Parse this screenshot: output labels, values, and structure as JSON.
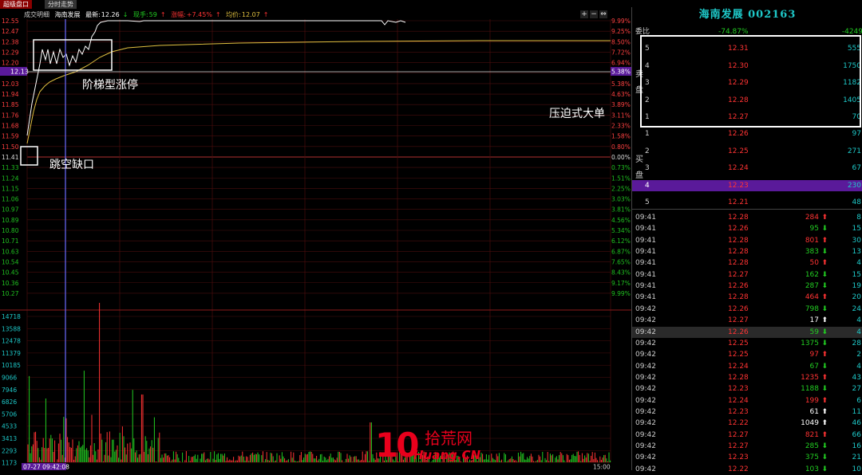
{
  "tabs": [
    {
      "label": "超级盘口",
      "active": true
    },
    {
      "label": "分时走势",
      "active": false
    }
  ],
  "info": {
    "prefix": "成交明细",
    "name": "海南发展",
    "latest_label": "最新:",
    "latest": "12.26",
    "volume_label": "现手:",
    "volume": "59",
    "change_label": "涨幅:",
    "change": "+7.45%",
    "avg_label": "均价:",
    "avg": "12.07"
  },
  "controls": [
    "+",
    "−",
    "⇔"
  ],
  "price_axis": [
    "12.55",
    "12.47",
    "12.38",
    "12.29",
    "12.20",
    "12.11",
    "12.03",
    "11.94",
    "11.85",
    "11.76",
    "11.68",
    "11.59",
    "11.50",
    "11.41",
    "11.33",
    "11.24",
    "11.15",
    "11.06",
    "10.97",
    "10.89",
    "10.80",
    "10.71",
    "10.63",
    "10.54",
    "10.45",
    "10.36",
    "10.27"
  ],
  "pct_axis": [
    "9.99%",
    "9.25%",
    "8.50%",
    "7.72%",
    "6.94%",
    "6.16%",
    "5.38%",
    "4.63%",
    "3.89%",
    "3.11%",
    "2.33%",
    "1.58%",
    "0.80%",
    "0.00%",
    "0.73%",
    "1.51%",
    "2.25%",
    "3.03%",
    "3.81%",
    "4.56%",
    "5.34%",
    "6.12%",
    "6.87%",
    "7.65%",
    "8.43%",
    "9.17%",
    "9.99%"
  ],
  "highlight_price": "12.13",
  "highlight_pct": "5.38%",
  "vol_axis": [
    "14718",
    "13588",
    "12478",
    "11379",
    "10185",
    "9066",
    "7946",
    "6826",
    "5706",
    "4533",
    "3413",
    "2293",
    "1173"
  ],
  "time_start": "07-27 09:42:08",
  "time_end": "15:00",
  "annotations": {
    "ladder": "阶梯型涨停",
    "gap": "跳空缺口",
    "pressure": "压迫式大单"
  },
  "watermark": {
    "num": "10",
    "cn": "拾荒网",
    "en": "Huang.CN"
  },
  "chart_data": {
    "type": "line",
    "y_range": [
      10.27,
      12.55
    ],
    "x_range": [
      "09:30",
      "15:00"
    ],
    "price_series_note": "",
    "volume_axis_range": [
      0,
      14718
    ]
  },
  "panel": {
    "title": "海南发展 002163",
    "weibi_label": "委比",
    "weibi_value": "-74.87%",
    "weicha_value": "-4249",
    "sell_label": "卖盘",
    "buy_label": "买盘",
    "sell": [
      {
        "level": "5",
        "price": "12.31",
        "vol": "555"
      },
      {
        "level": "4",
        "price": "12.30",
        "vol": "1750"
      },
      {
        "level": "3",
        "price": "12.29",
        "vol": "1182"
      },
      {
        "level": "2",
        "price": "12.28",
        "vol": "1405"
      },
      {
        "level": "1",
        "price": "12.27",
        "vol": "70"
      }
    ],
    "buy": [
      {
        "level": "1",
        "price": "12.26",
        "vol": "97"
      },
      {
        "level": "2",
        "price": "12.25",
        "vol": "271"
      },
      {
        "level": "3",
        "price": "12.24",
        "vol": "67"
      },
      {
        "level": "4",
        "price": "12.23",
        "vol": "230"
      },
      {
        "level": "5",
        "price": "12.21",
        "vol": "48"
      }
    ],
    "trades": [
      {
        "time": "09:41",
        "price": "12.28",
        "vol": "284",
        "dir": "up",
        "n": "8"
      },
      {
        "time": "09:41",
        "price": "12.26",
        "vol": "95",
        "dir": "down",
        "n": "15"
      },
      {
        "time": "09:41",
        "price": "12.28",
        "vol": "801",
        "dir": "up",
        "n": "30"
      },
      {
        "time": "09:41",
        "price": "12.28",
        "vol": "383",
        "dir": "down",
        "n": "13"
      },
      {
        "time": "09:41",
        "price": "12.28",
        "vol": "50",
        "dir": "up",
        "n": "4"
      },
      {
        "time": "09:41",
        "price": "12.27",
        "vol": "162",
        "dir": "down",
        "n": "15"
      },
      {
        "time": "09:41",
        "price": "12.26",
        "vol": "287",
        "dir": "down",
        "n": "19"
      },
      {
        "time": "09:41",
        "price": "12.28",
        "vol": "464",
        "dir": "up",
        "n": "20"
      },
      {
        "time": "09:42",
        "price": "12.26",
        "vol": "798",
        "dir": "down",
        "n": "24"
      },
      {
        "time": "09:42",
        "price": "12.27",
        "vol": "17",
        "dir": "white",
        "n": "4"
      },
      {
        "time": "09:42",
        "price": "12.26",
        "vol": "59",
        "dir": "down",
        "n": "4",
        "highlight": true
      },
      {
        "time": "09:42",
        "price": "12.25",
        "vol": "1375",
        "dir": "down",
        "n": "28"
      },
      {
        "time": "09:42",
        "price": "12.25",
        "vol": "97",
        "dir": "up",
        "n": "2"
      },
      {
        "time": "09:42",
        "price": "12.24",
        "vol": "67",
        "dir": "down",
        "n": "4"
      },
      {
        "time": "09:42",
        "price": "12.28",
        "vol": "1235",
        "dir": "up",
        "n": "43"
      },
      {
        "time": "09:42",
        "price": "12.23",
        "vol": "1188",
        "dir": "down",
        "n": "27"
      },
      {
        "time": "09:42",
        "price": "12.24",
        "vol": "199",
        "dir": "up",
        "n": "6"
      },
      {
        "time": "09:42",
        "price": "12.23",
        "vol": "61",
        "dir": "white",
        "n": "11"
      },
      {
        "time": "09:42",
        "price": "12.22",
        "vol": "1049",
        "dir": "white",
        "n": "46"
      },
      {
        "time": "09:42",
        "price": "12.27",
        "vol": "821",
        "dir": "up",
        "n": "66"
      },
      {
        "time": "09:42",
        "price": "12.27",
        "vol": "285",
        "dir": "down",
        "n": "16"
      },
      {
        "time": "09:42",
        "price": "12.23",
        "vol": "375",
        "dir": "down",
        "n": "21"
      },
      {
        "time": "09:42",
        "price": "12.22",
        "vol": "103",
        "dir": "down",
        "n": "10"
      }
    ]
  },
  "colors": {
    "up": "#ff3333",
    "down": "#22cc22",
    "axis_price": "#ff4040",
    "axis_below": "#20c020",
    "highlight": "#5a1a9a",
    "cyan": "#1ec8c8"
  }
}
